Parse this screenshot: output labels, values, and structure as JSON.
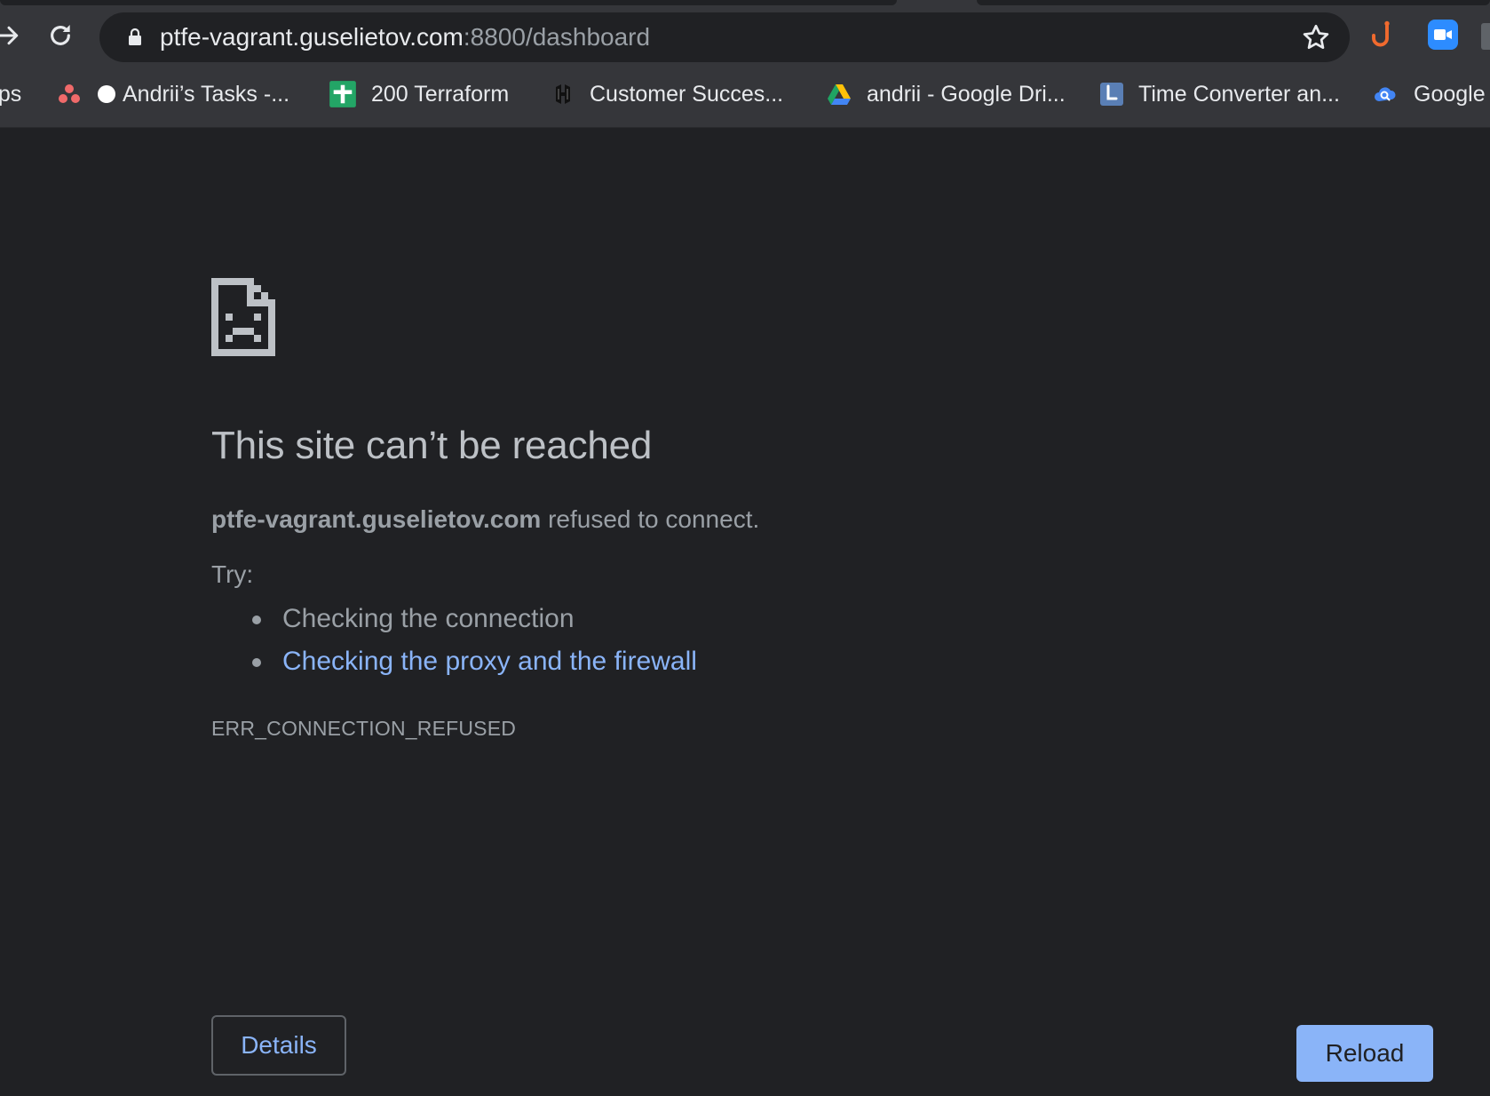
{
  "browser": {
    "address_bar": {
      "host": "ptfe-vagrant.guselietov.com",
      "path": ":8800/dashboard"
    },
    "bookmarks": [
      {
        "label": "ops",
        "icon": "apps-icon"
      },
      {
        "label": "Andrii’s Tasks -...",
        "icon": "asana-icon"
      },
      {
        "label": "200 Terraform",
        "icon": "google-sheets-icon"
      },
      {
        "label": "Customer Succes...",
        "icon": "hashicorp-icon"
      },
      {
        "label": "andrii - Google Dri...",
        "icon": "google-drive-icon"
      },
      {
        "label": "Time Converter an...",
        "icon": "clock-icon"
      },
      {
        "label": "Google",
        "icon": "cloud-search-icon"
      }
    ]
  },
  "error_page": {
    "title": "This site can’t be reached",
    "host": "ptfe-vagrant.guselietov.com",
    "summary_suffix": " refused to connect.",
    "try_label": "Try:",
    "suggestions": {
      "check_connection": "Checking the connection",
      "check_proxy": "Checking the proxy and the firewall"
    },
    "error_code": "ERR_CONNECTION_REFUSED",
    "details_label": "Details",
    "reload_label": "Reload"
  },
  "colors": {
    "background": "#202124",
    "chrome": "#35363a",
    "text": "#9aa0a6",
    "heading": "#bdc1c6",
    "link": "#8ab4f8",
    "button": "#8ab4f8"
  }
}
